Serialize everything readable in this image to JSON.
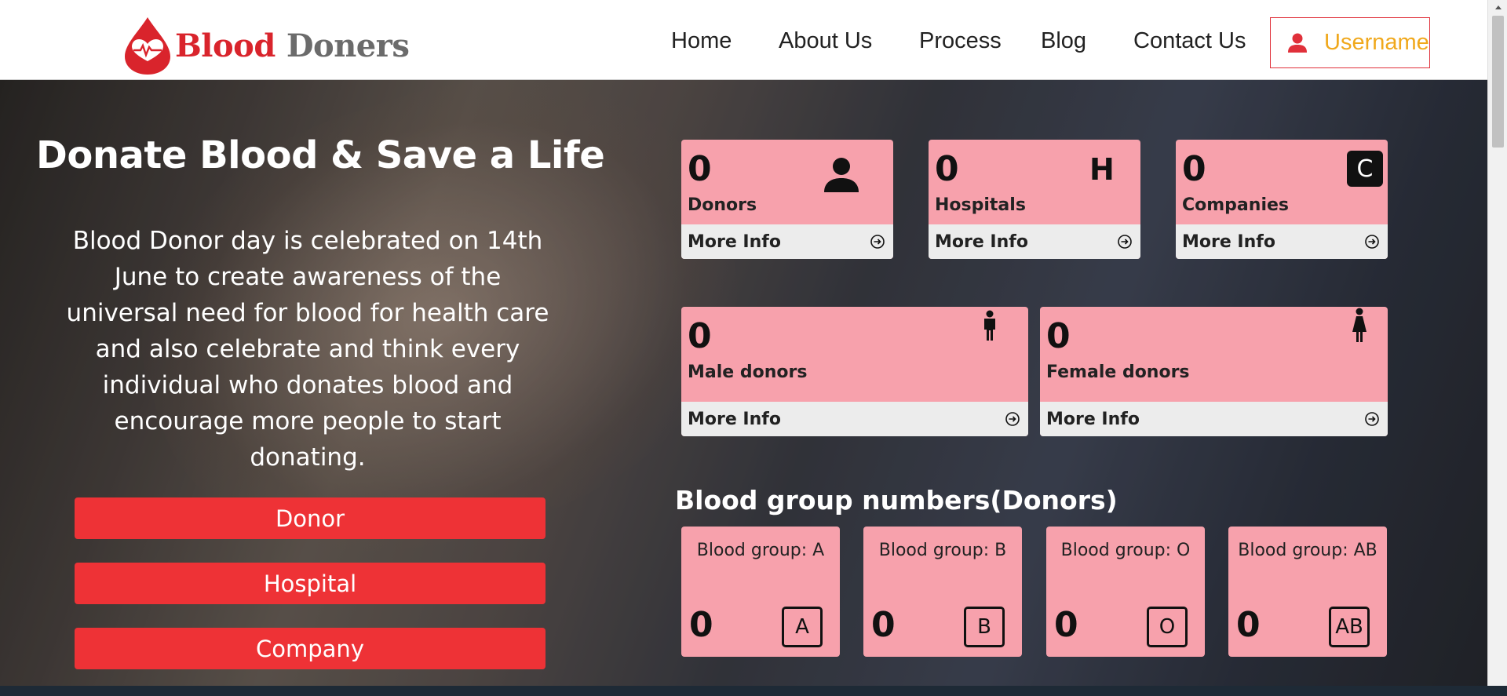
{
  "brand": {
    "name_part1": "Blood",
    "name_part2": "Doners"
  },
  "nav": {
    "items": [
      "Home",
      "About Us",
      "Process",
      "Blog",
      "Contact Us"
    ]
  },
  "user": {
    "label": "Username"
  },
  "hero": {
    "title": "Donate Blood & Save a Life",
    "description": "Blood Donor day is celebrated on 14th June to create awareness of the universal need for blood for health care and also celebrate and think every individual who donates blood and encourage more people to start donating.",
    "buttons": [
      "Donor",
      "Hospital",
      "Company"
    ]
  },
  "stats": [
    {
      "count": "0",
      "label": "Donors",
      "more": "More Info",
      "icon": "person-icon"
    },
    {
      "count": "0",
      "label": "Hospitals",
      "more": "More Info",
      "icon": "hospital-icon",
      "icon_text": "H"
    },
    {
      "count": "0",
      "label": "Companies",
      "more": "More Info",
      "icon": "company-icon",
      "icon_text": "C"
    },
    {
      "count": "0",
      "label": "Male donors",
      "more": "More Info",
      "icon": "male-icon"
    },
    {
      "count": "0",
      "label": "Female donors",
      "more": "More Info",
      "icon": "female-icon"
    }
  ],
  "blood_groups": {
    "title": "Blood group numbers(Donors)",
    "items": [
      {
        "label": "Blood group: A",
        "count": "0",
        "badge": "A"
      },
      {
        "label": "Blood group: B",
        "count": "0",
        "badge": "B"
      },
      {
        "label": "Blood group: O",
        "count": "0",
        "badge": "O"
      },
      {
        "label": "Blood group: AB",
        "count": "0",
        "badge": "AB"
      }
    ]
  },
  "colors": {
    "brand_red": "#d9242c",
    "button_red": "#ee3236",
    "card_pink": "#f7a1ac",
    "username_gold": "#f0a81c"
  }
}
